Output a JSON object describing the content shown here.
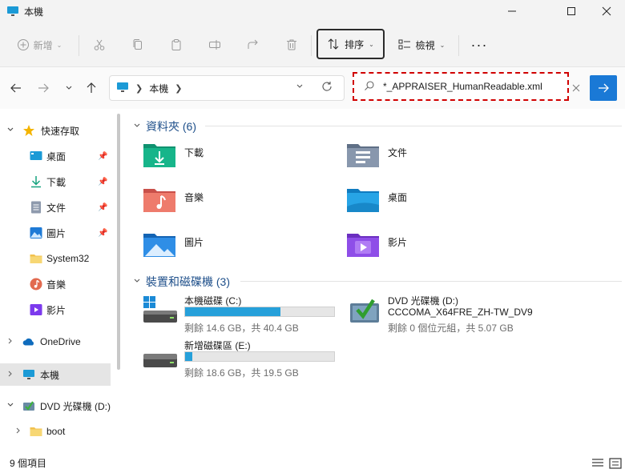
{
  "window": {
    "title": "本機",
    "minimize_icon": "minimize-icon",
    "maximize_icon": "maximize-icon",
    "close_icon": "close-icon"
  },
  "toolbar": {
    "new_label": "新增",
    "sort_label": "排序",
    "view_label": "檢視",
    "more_label": "···"
  },
  "address": {
    "crumb": "本機"
  },
  "search": {
    "value": "*_APPRAISER_HumanReadable.xml"
  },
  "sidebar": {
    "items": [
      {
        "label": "快速存取",
        "icon": "star-icon"
      },
      {
        "label": "桌面",
        "icon": "desktop-icon",
        "pinned": true
      },
      {
        "label": "下載",
        "icon": "download-icon",
        "pinned": true
      },
      {
        "label": "文件",
        "icon": "document-icon",
        "pinned": true
      },
      {
        "label": "圖片",
        "icon": "picture-icon",
        "pinned": true
      },
      {
        "label": "System32",
        "icon": "folder-icon"
      },
      {
        "label": "音樂",
        "icon": "music-icon"
      },
      {
        "label": "影片",
        "icon": "video-icon"
      },
      {
        "label": "OneDrive",
        "icon": "cloud-icon"
      },
      {
        "label": "本機",
        "icon": "computer-icon"
      },
      {
        "label": "DVD 光碟機 (D:)",
        "icon": "dvd-icon"
      },
      {
        "label": "boot",
        "icon": "folder-icon"
      }
    ]
  },
  "main": {
    "folders_header": "資料夾 (6)",
    "folders": [
      {
        "label": "下載",
        "icon": "downloads-folder-icon"
      },
      {
        "label": "文件",
        "icon": "documents-folder-icon"
      },
      {
        "label": "音樂",
        "icon": "music-folder-icon"
      },
      {
        "label": "桌面",
        "icon": "desktop-folder-icon"
      },
      {
        "label": "圖片",
        "icon": "pictures-folder-icon"
      },
      {
        "label": "影片",
        "icon": "videos-folder-icon"
      }
    ],
    "drives_header": "裝置和磁碟機 (3)",
    "drives": [
      {
        "name": "本機磁碟 (C:)",
        "free": "剩餘 14.6 GB，共 40.4 GB",
        "used_fraction": 0.64,
        "icon": "windows-drive-icon"
      },
      {
        "name": "新增磁碟區 (E:)",
        "free": "剩餘 18.6 GB，共 19.5 GB",
        "used_fraction": 0.05,
        "icon": "drive-icon"
      },
      {
        "name": "DVD 光碟機 (D:)",
        "name2": "CCCOMA_X64FRE_ZH-TW_DV9",
        "free": "剩餘 0 個位元組，共 5.07 GB",
        "icon": "dvd-drive-icon"
      }
    ]
  },
  "status": {
    "count": "9 個項目"
  },
  "colors": {
    "accent": "#1a79d6",
    "drive_fill": "#26a0da",
    "highlight_border": "#d00000"
  }
}
